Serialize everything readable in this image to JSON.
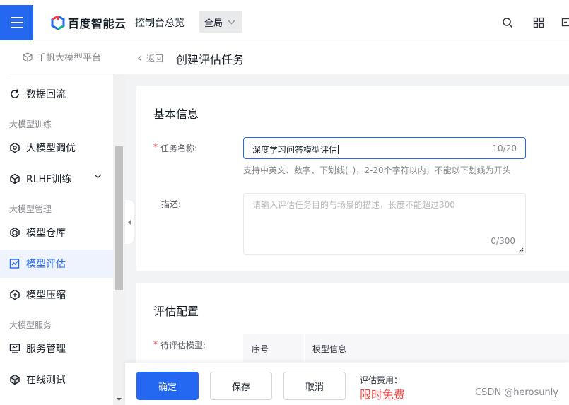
{
  "topbar": {
    "brand": "百度智能云",
    "console": "控制台总览",
    "region": "全局"
  },
  "sidebar": {
    "platform": "千帆大模型平台",
    "items": [
      {
        "label": "数据回流"
      },
      {
        "group": "大模型训练"
      },
      {
        "label": "大模型调优"
      },
      {
        "label": "RLHF训练"
      },
      {
        "group": "大模型管理"
      },
      {
        "label": "模型仓库"
      },
      {
        "label": "模型评估",
        "active": true
      },
      {
        "label": "模型压缩"
      },
      {
        "group": "大模型服务"
      },
      {
        "label": "服务管理"
      },
      {
        "label": "在线测试"
      }
    ],
    "labels": {
      "data_backflow": "数据回流",
      "group_training": "大模型训练",
      "fine_tune": "大模型调优",
      "rlhf": "RLHF训练",
      "group_management": "大模型管理",
      "model_repo": "模型仓库",
      "model_eval": "模型评估",
      "model_compress": "模型压缩",
      "group_service": "大模型服务",
      "service_mgmt": "服务管理",
      "online_test": "在线测试"
    }
  },
  "header": {
    "back": "返回",
    "title": "创建评估任务"
  },
  "basic_info": {
    "title": "基本信息",
    "name_label": "任务名称:",
    "name_value": "深度学习问答模型评估",
    "name_count": "10/20",
    "name_hint": "支持中英文、数字、下划线(_)，2-20个字符以内，不能以下划线为开头",
    "desc_label": "描述:",
    "desc_placeholder": "请输入评估任务目的与场景的描述，长度不能超过300",
    "desc_count": "0/300"
  },
  "eval_config": {
    "title": "评估配置",
    "model_label": "待评估模型:",
    "columns": [
      "序号",
      "模型信息"
    ]
  },
  "footer": {
    "confirm": "确定",
    "save": "保存",
    "cancel": "取消",
    "fee_label": "评估费用：",
    "fee_value": "限时免费"
  },
  "watermark": "CSDN @herosunly",
  "colors": {
    "primary": "#2468f2",
    "danger": "#f33e3e",
    "active_bg": "#eef3fe"
  }
}
